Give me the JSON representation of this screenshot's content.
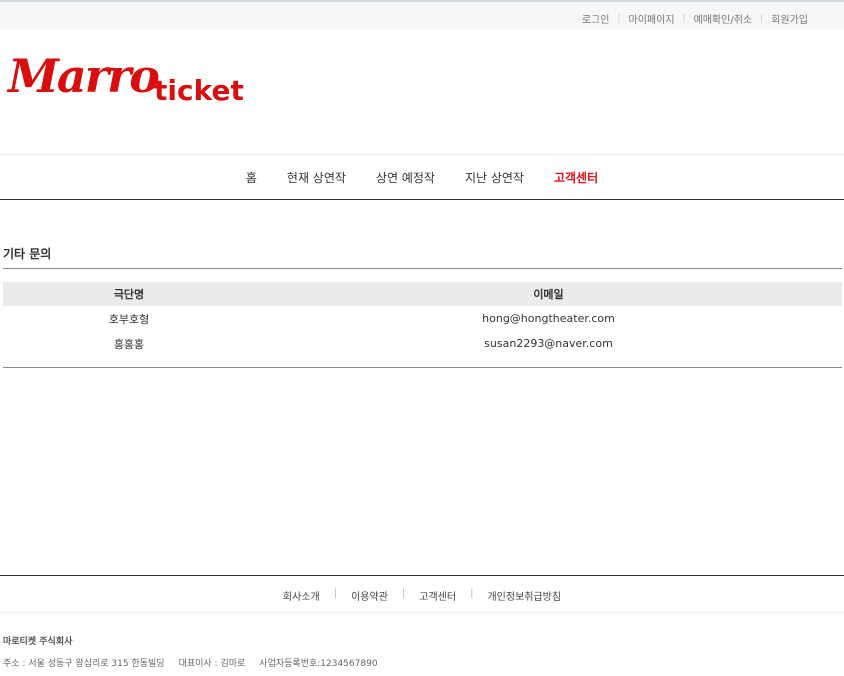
{
  "top_links": {
    "login": "로그인",
    "mypage": "마이페이지",
    "reservation": "예매확인/취소",
    "signup": "회원가입"
  },
  "logo": {
    "script": "Marro",
    "word": "ticket",
    "color": "#d90f0f"
  },
  "nav": {
    "home": "홈",
    "current": "현재 상연작",
    "upcoming": "상연 예정작",
    "past": "지난 상연작",
    "support": "고객센터",
    "active_color": "#e0121b"
  },
  "section": {
    "title": "기타 문의"
  },
  "table": {
    "headers": [
      "극단명",
      "이메일"
    ],
    "rows": [
      [
        "호부호형",
        "hong@hongtheater.com"
      ],
      [
        "홍홍홍",
        "susan2293@naver.com"
      ]
    ]
  },
  "footer": {
    "links": [
      "회사소개",
      "이용약관",
      "고객센터",
      "개인정보취급방침"
    ],
    "company": "마로티켓 주식회사",
    "address": "주소 : 서울 성동구 왕십리로 315 한동빌딩",
    "ceo": "대표이사 : 김마로",
    "business_no": "사업자등록번호:1234567890"
  }
}
